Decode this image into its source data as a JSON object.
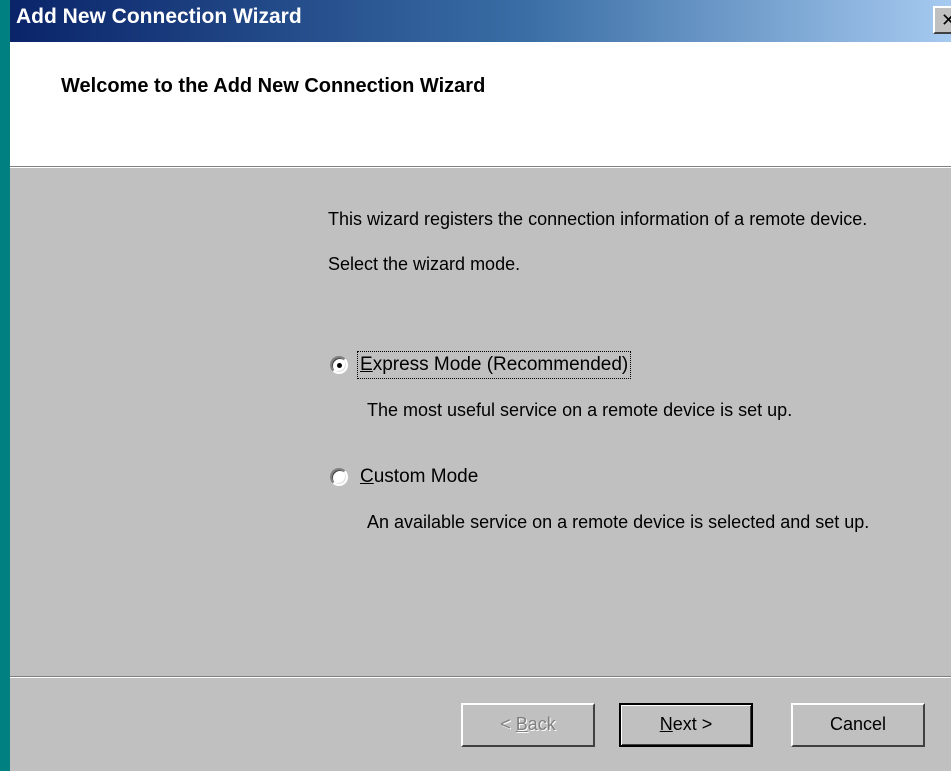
{
  "window": {
    "title": "Add New Connection Wizard",
    "close_label": "✕"
  },
  "header": {
    "title": "Welcome to the Add New Connection Wizard"
  },
  "main": {
    "description_line1": "This wizard registers the connection information of a remote device.",
    "description_line2": "Select the wizard mode.",
    "options": [
      {
        "label_prefix": "",
        "label_mnemonic": "E",
        "label_rest": "xpress Mode (Recommended)",
        "selected": true,
        "description": "The most useful service on a remote device is set up."
      },
      {
        "label_prefix": "",
        "label_mnemonic": "C",
        "label_rest": "ustom Mode",
        "selected": false,
        "description": "An available service on a remote device is selected and set up."
      }
    ]
  },
  "footer": {
    "back_prefix": "< ",
    "back_mnemonic": "B",
    "back_rest": "ack",
    "next_mnemonic": "N",
    "next_rest": "ext >",
    "cancel_label": "Cancel"
  },
  "colors": {
    "titlebar_start": "#0a246a",
    "titlebar_end": "#a6caf0",
    "dialog_bg": "#c0c0c0",
    "desktop_bg": "#008080"
  }
}
